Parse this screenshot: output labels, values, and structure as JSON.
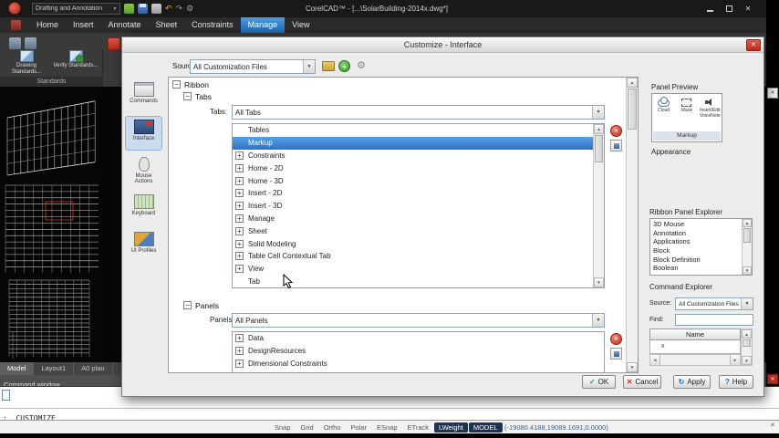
{
  "titlebar": {
    "title": "CorelCAD™ - [...\\SolarBuilding-2014x.dwg*]",
    "workspace_value": "Drafting and Annotation"
  },
  "menu_tabs": {
    "items": [
      "Home",
      "Insert",
      "Annotate",
      "Sheet",
      "Constraints",
      "Manage",
      "View"
    ],
    "active": "Manage"
  },
  "ribbon": {
    "standards_buttons": [
      "Drawing Standards...",
      "Verify Standards..."
    ],
    "standards_caption": "Standards"
  },
  "viewport": {
    "doc_tabs": [
      "Model",
      "Layout1",
      "A0 plan"
    ],
    "active_doc_tab": "Model"
  },
  "command_area": {
    "window_title": "Command window",
    "prompt": ": _CUSTOMIZE"
  },
  "statusbar": {
    "toggles": [
      "Snap",
      "Grid",
      "Ortho",
      "Polar",
      "ESnap",
      "ETrack",
      "LWeight",
      "MODEL"
    ],
    "active_toggles": [
      "LWeight",
      "MODEL"
    ],
    "coordinates": "(-19080.4188,19089.1691,0.0000)"
  },
  "dialog": {
    "title": "Customize - Interface",
    "source_label": "Source:",
    "source_value": "All Customization Files",
    "sidebar_items": [
      {
        "label": "Commands",
        "selected": false
      },
      {
        "label": "Interface",
        "selected": true
      },
      {
        "label": "Mouse Actions",
        "selected": false
      },
      {
        "label": "Keyboard",
        "selected": false
      },
      {
        "label": "UI Profiles",
        "selected": false
      }
    ],
    "tree_root": "Ribbon",
    "tree_child": "Tabs",
    "tabs_label": "Tabs:",
    "tabs_value": "All Tabs",
    "tab_items": [
      {
        "label": "Tables",
        "expander": false,
        "selected": false
      },
      {
        "label": "Markup",
        "expander": false,
        "selected": true
      },
      {
        "label": "Constraints",
        "expander": true,
        "selected": false
      },
      {
        "label": "Home - 2D",
        "expander": true,
        "selected": false
      },
      {
        "label": "Home - 3D",
        "expander": true,
        "selected": false
      },
      {
        "label": "Insert - 2D",
        "expander": true,
        "selected": false
      },
      {
        "label": "Insert - 3D",
        "expander": true,
        "selected": false
      },
      {
        "label": "Manage",
        "expander": true,
        "selected": false
      },
      {
        "label": "Sheet",
        "expander": true,
        "selected": false
      },
      {
        "label": "Solid Modeling",
        "expander": true,
        "selected": false
      },
      {
        "label": "Table Cell Contextual Tab",
        "expander": true,
        "selected": false
      },
      {
        "label": "View",
        "expander": true,
        "selected": false
      },
      {
        "label": "Tab",
        "expander": false,
        "selected": false
      }
    ],
    "panels_node": "Panels",
    "panels_label": "Panels:",
    "panels_value": "All Panels",
    "panel_items": [
      {
        "label": "Data",
        "expander": true,
        "selected": false
      },
      {
        "label": "DesignResources",
        "expander": true,
        "selected": false
      },
      {
        "label": "Dimensional Constraints",
        "expander": true,
        "selected": false
      }
    ],
    "panel_preview_label": "Panel Preview",
    "preview_buttons": [
      "Cloud",
      "Mask",
      "Insert/Edit VoiceNote"
    ],
    "preview_caption": "Markup",
    "appearance_label": "Appearance",
    "rpe_label": "Ribbon Panel Explorer",
    "rpe_items": [
      "3D Mouse",
      "Annotation",
      "Applications",
      "Block",
      "Block Definition",
      "Boolean"
    ],
    "ce_label": "Command Explorer",
    "ce_source_label": "Source:",
    "ce_source_value": "All Customization Files",
    "ce_find_label": "Find:",
    "ce_name_header": "Name",
    "ce_row_value": "x",
    "buttons": {
      "ok": "OK",
      "cancel": "Cancel",
      "apply": "Apply",
      "help": "Help"
    }
  },
  "icons": {
    "close": "✕",
    "dropdown": "▼",
    "up": "▲",
    "down": "▼",
    "left": "◄",
    "right": "►",
    "plus": "+",
    "minus": "−",
    "check": "✓",
    "cross": "✕",
    "help": "?",
    "apply": "↻",
    "undo": "↶",
    "redo": "↷",
    "gear": "⚙"
  }
}
